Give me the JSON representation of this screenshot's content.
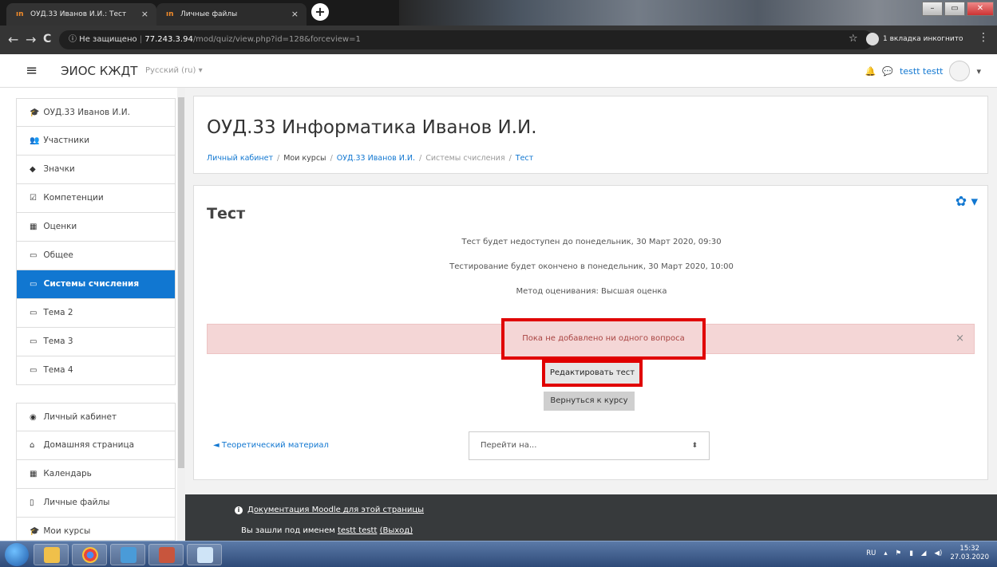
{
  "browser": {
    "tabs": [
      {
        "label": "ОУД.33 Иванов И.И.: Тест",
        "close": "×"
      },
      {
        "label": "Личные файлы",
        "close": "×"
      }
    ],
    "new_tab": "+",
    "nav": {
      "back": "←",
      "forward": "→",
      "reload": "C"
    },
    "url": {
      "security": "ⓘ Не защищено",
      "host": "77.243.3.94",
      "path": "/mod/quiz/view.php?id=128&forceview=1"
    },
    "incognito": "1 вкладка инкогнито",
    "star": "☆",
    "menu": "⋮",
    "window": {
      "min": "–",
      "max": "▭",
      "close": "✕"
    }
  },
  "header": {
    "menu_icon": "≡",
    "brand": "ЭИОС КЖДТ",
    "language": "Русский (ru) ▾",
    "user": "testt testt",
    "user_menu": "▾"
  },
  "sidebar": {
    "items": [
      {
        "icon": "🎓",
        "label": "ОУД.33 Иванов И.И."
      },
      {
        "icon": "👥",
        "label": "Участники"
      },
      {
        "icon": "◆",
        "label": "Значки"
      },
      {
        "icon": "☑",
        "label": "Компетенции"
      },
      {
        "icon": "▦",
        "label": "Оценки"
      },
      {
        "icon": "▭",
        "label": "Общее"
      },
      {
        "icon": "▭",
        "label": "Системы счисления",
        "active": true
      },
      {
        "icon": "▭",
        "label": "Тема 2"
      },
      {
        "icon": "▭",
        "label": "Тема 3"
      },
      {
        "icon": "▭",
        "label": "Тема 4"
      },
      {
        "icon": "◉",
        "label": "Личный кабинет"
      },
      {
        "icon": "⌂",
        "label": "Домашняя страница"
      },
      {
        "icon": "▦",
        "label": "Календарь"
      },
      {
        "icon": "▯",
        "label": "Личные файлы"
      },
      {
        "icon": "🎓",
        "label": "Мои курсы"
      }
    ]
  },
  "course": {
    "title": "ОУД.33 Информатика Иванов И.И.",
    "breadcrumbs": [
      "Личный кабинет",
      "Мои курсы",
      "ОУД.33 Иванов И.И.",
      "Системы счисления",
      "Тест"
    ]
  },
  "quiz": {
    "title": "Тест",
    "gear": "✿ ▾",
    "open_info": "Тест будет недоступен до понедельник, 30 Март 2020, 09:30",
    "close_info": "Тестирование будет окончено в понедельник, 30 Март 2020, 10:00",
    "grading": "Метод оценивания: Высшая оценка",
    "alert": "Пока не добавлено ни одного вопроса",
    "alert_close": "×",
    "edit_button": "Редактировать тест",
    "back_button": "Вернуться к курсу",
    "prev_link": "◄ Теоретический материал",
    "jump_placeholder": "Перейти на...",
    "jump_arrow": "⬍"
  },
  "footer": {
    "docs_icon": "i",
    "docs_link": "Документация Moodle для этой страницы",
    "login_prefix": "Вы зашли под именем",
    "login_user": "testt testt",
    "logout": "(Выход)"
  },
  "taskbar": {
    "lang": "RU",
    "time": "15:32",
    "date": "27.03.2020"
  }
}
